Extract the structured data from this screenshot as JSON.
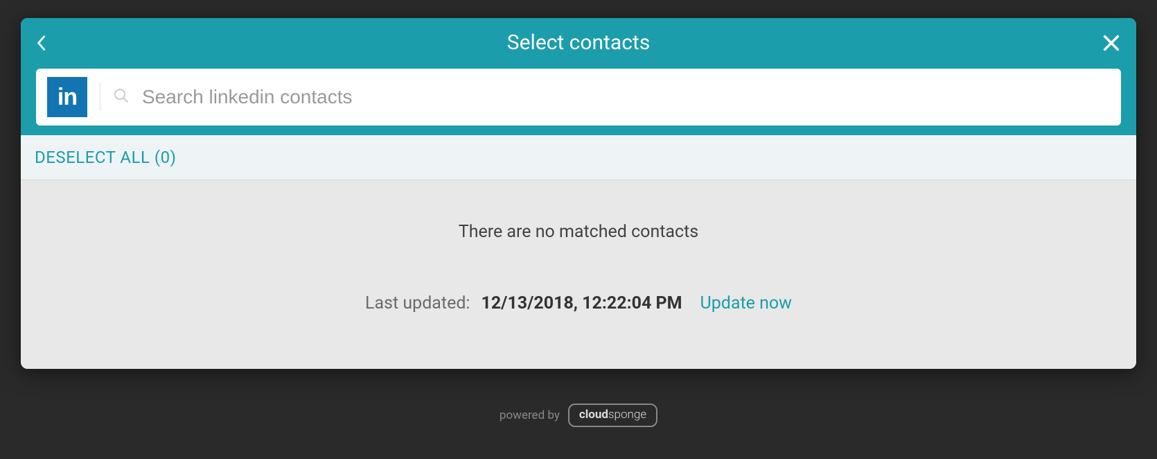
{
  "header": {
    "title": "Select contacts"
  },
  "search": {
    "provider": "in",
    "placeholder": "Search linkedin contacts"
  },
  "toolbar": {
    "deselect_label": "DESELECT ALL (0)"
  },
  "body": {
    "empty_message": "There are no matched contacts",
    "last_updated_label": "Last updated:",
    "last_updated_value": "12/13/2018, 12:22:04 PM",
    "update_link": "Update now"
  },
  "footer": {
    "powered_by": "powered by",
    "brand_bold": "cloud",
    "brand_light": "sponge"
  }
}
